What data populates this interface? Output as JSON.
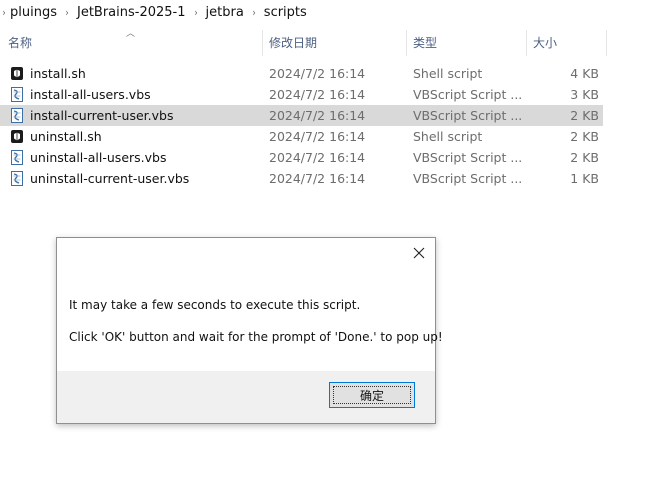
{
  "breadcrumb": {
    "items": [
      "pluings",
      "JetBrains-2025-1",
      "jetbra",
      "scripts"
    ]
  },
  "columns": {
    "name": "名称",
    "date": "修改日期",
    "type": "类型",
    "size": "大小"
  },
  "files": [
    {
      "name": "install.sh",
      "date": "2024/7/2 16:14",
      "type": "Shell script",
      "size": "4 KB",
      "icon": "shell-script-icon",
      "selected": false
    },
    {
      "name": "install-all-users.vbs",
      "date": "2024/7/2 16:14",
      "type": "VBScript Script ...",
      "size": "3 KB",
      "icon": "vbscript-icon",
      "selected": false
    },
    {
      "name": "install-current-user.vbs",
      "date": "2024/7/2 16:14",
      "type": "VBScript Script ...",
      "size": "2 KB",
      "icon": "vbscript-icon",
      "selected": true
    },
    {
      "name": "uninstall.sh",
      "date": "2024/7/2 16:14",
      "type": "Shell script",
      "size": "2 KB",
      "icon": "shell-script-icon",
      "selected": false
    },
    {
      "name": "uninstall-all-users.vbs",
      "date": "2024/7/2 16:14",
      "type": "VBScript Script ...",
      "size": "2 KB",
      "icon": "vbscript-icon",
      "selected": false
    },
    {
      "name": "uninstall-current-user.vbs",
      "date": "2024/7/2 16:14",
      "type": "VBScript Script ...",
      "size": "1 KB",
      "icon": "vbscript-icon",
      "selected": false
    }
  ],
  "dialog": {
    "message_line1": "It may take a few seconds to execute this script.",
    "message_line2": "Click 'OK' button and wait for the prompt of 'Done.' to pop up!",
    "ok_label": "确定"
  },
  "colors": {
    "selection": "#d9d9d9",
    "header_text": "#4d6082",
    "button_border": "#0078d7"
  }
}
